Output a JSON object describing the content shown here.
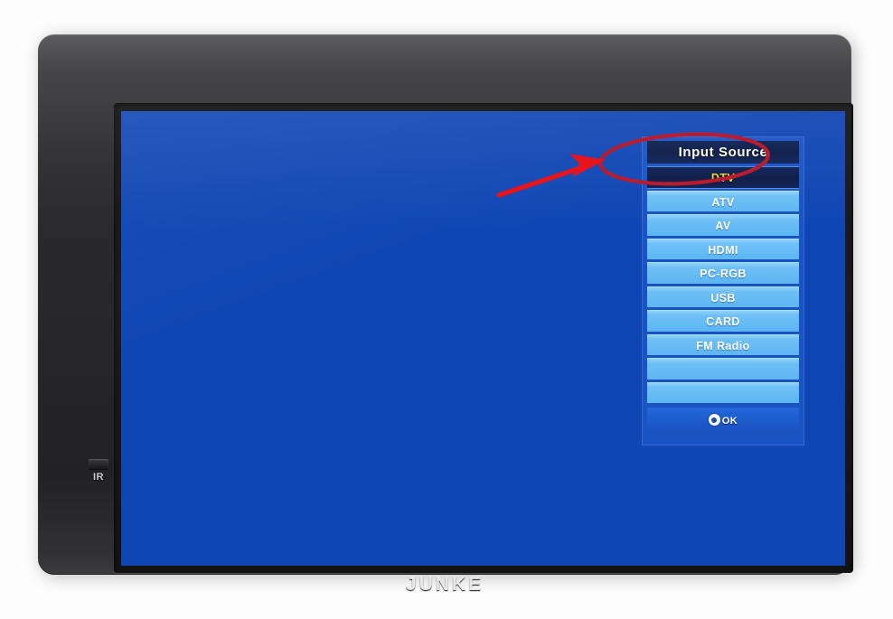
{
  "device": {
    "brand": "JUNKE",
    "ir_label": "IR",
    "bezel_color": "#272729",
    "screen_color": "#1046b4"
  },
  "osd": {
    "title": "Input Source",
    "selected_index": 0,
    "selected_text_color": "#f5d33c",
    "item_text_color": "#ffffff",
    "item_bg_color": "#6ec0f6",
    "selected_bg_color": "#0a1a46",
    "panel_bg_color": "#1a53c4",
    "items": [
      {
        "label": "DTV",
        "selected": true
      },
      {
        "label": "ATV",
        "selected": false
      },
      {
        "label": "AV",
        "selected": false
      },
      {
        "label": "HDMI",
        "selected": false
      },
      {
        "label": "PC-RGB",
        "selected": false
      },
      {
        "label": "USB",
        "selected": false
      },
      {
        "label": "CARD",
        "selected": false
      },
      {
        "label": "FM Radio",
        "selected": false
      },
      {
        "label": "",
        "selected": false
      },
      {
        "label": "",
        "selected": false
      }
    ],
    "confirm": {
      "label": "OK",
      "icon": "ok-target-icon"
    }
  },
  "annotation": {
    "ellipse_color": "#c0182b",
    "arrow_color": "#e60f18",
    "ellipse_target": "DTV / ATV rows",
    "arrow_points_to": "DTV"
  }
}
